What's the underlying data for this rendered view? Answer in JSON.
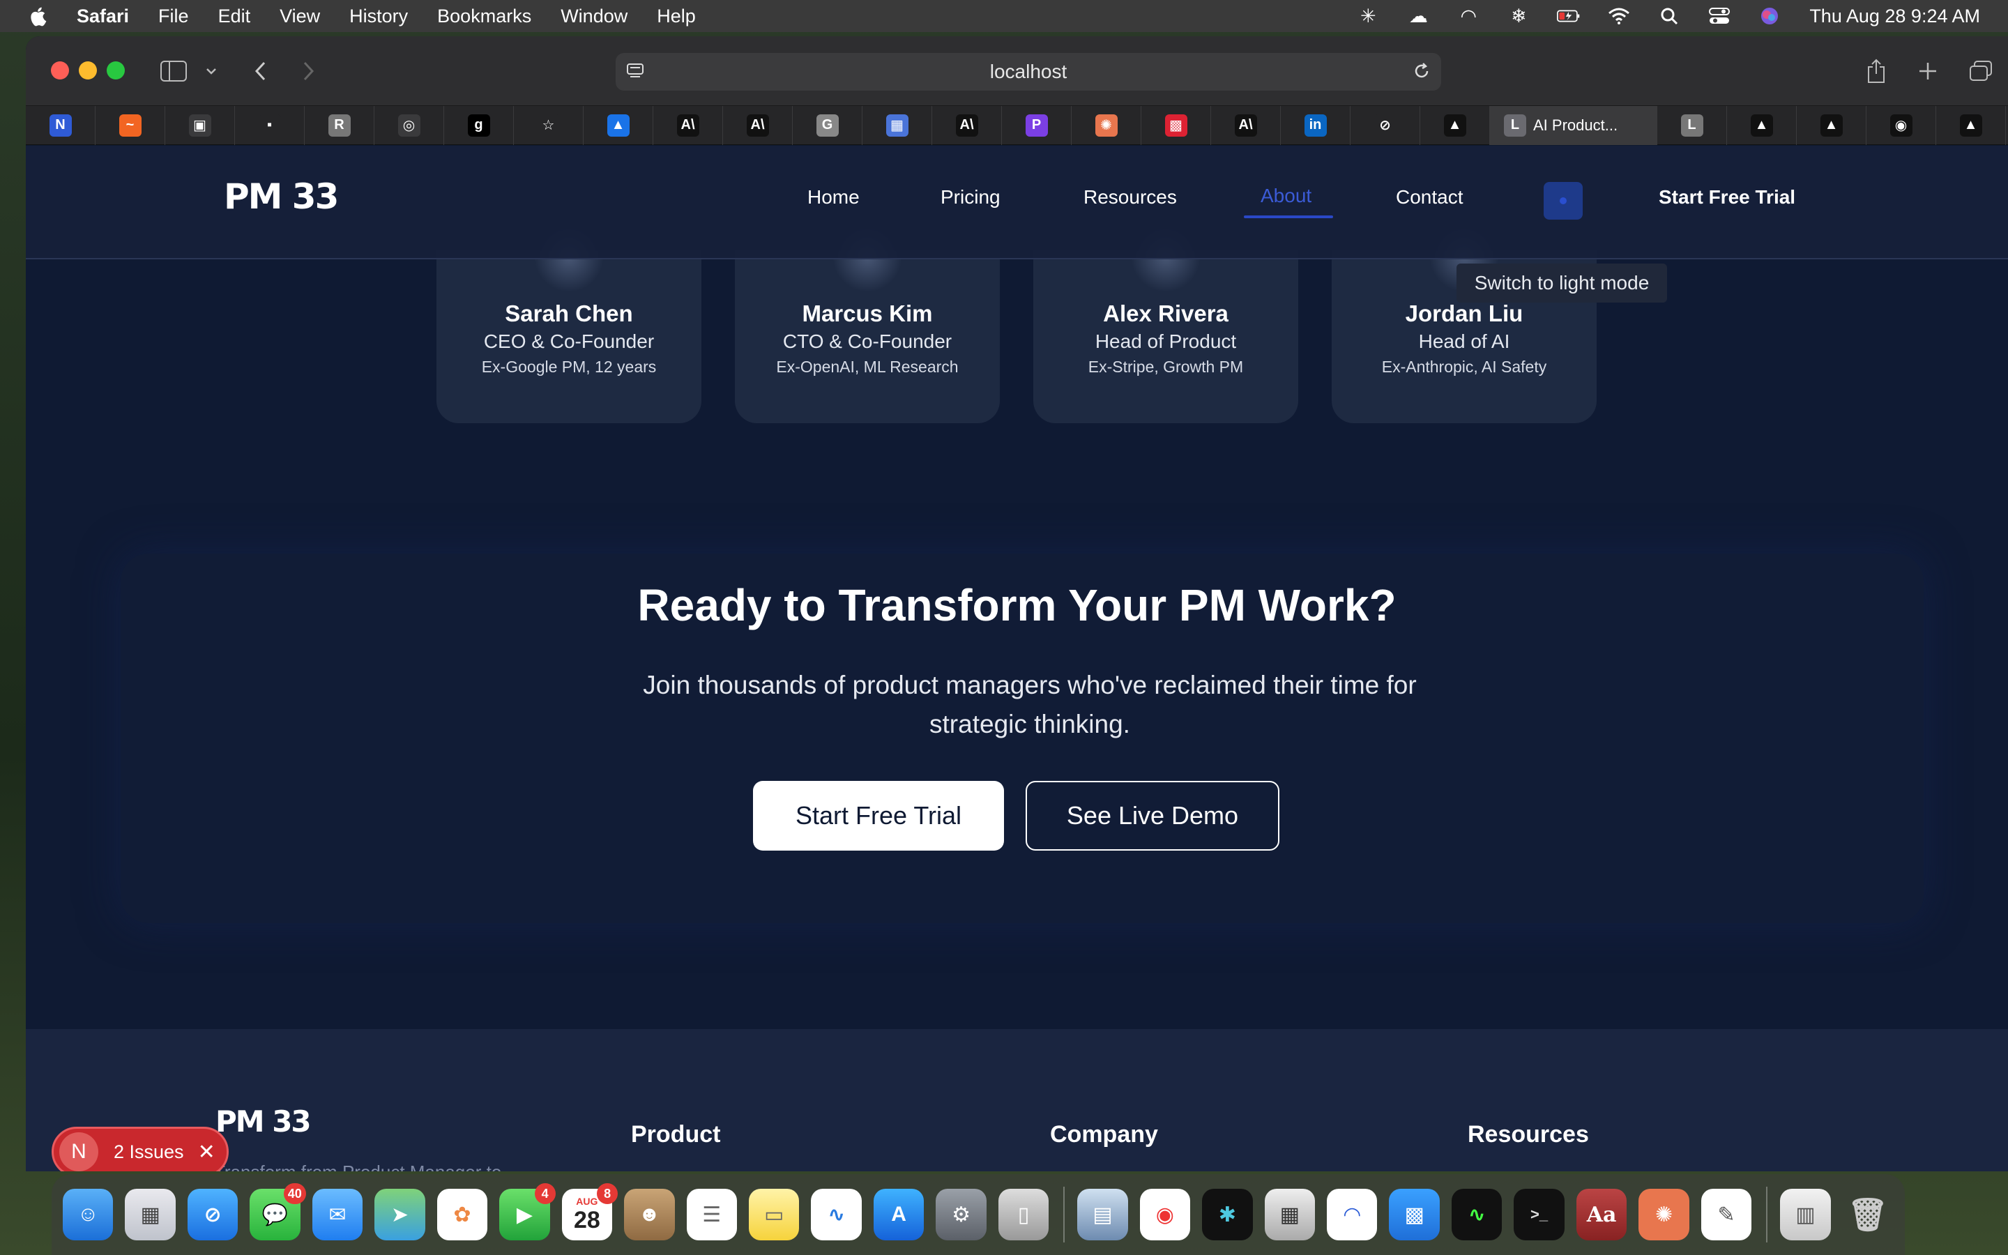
{
  "menubar": {
    "app": "Safari",
    "items": [
      "File",
      "Edit",
      "View",
      "History",
      "Bookmarks",
      "Window",
      "Help"
    ],
    "clock": "Thu Aug 28  9:24 AM",
    "status_icons": [
      "asterisk-icon",
      "cloud-icon",
      "arc-icon",
      "snowflake-icon",
      "battery-icon",
      "wifi-icon",
      "search-icon",
      "control-center-icon",
      "siri-icon"
    ]
  },
  "browser": {
    "url": "localhost",
    "active_tab": "AI Product...",
    "favorites": [
      {
        "glyph": "N",
        "color": "#2f5bd6"
      },
      {
        "glyph": "~",
        "color": "#f26522"
      },
      {
        "glyph": "▣",
        "color": "#3a3a3c"
      },
      {
        "glyph": "▪",
        "color": "#262628"
      },
      {
        "glyph": "R",
        "color": "#777"
      },
      {
        "glyph": "◎",
        "color": "#3a3a3c"
      },
      {
        "glyph": "g",
        "color": "#000"
      },
      {
        "glyph": "☆",
        "color": "#262628"
      },
      {
        "glyph": "▲",
        "color": "#1a73e8"
      },
      {
        "glyph": "A\\",
        "color": "#111"
      },
      {
        "glyph": "A\\",
        "color": "#111"
      },
      {
        "glyph": "G",
        "color": "#888"
      },
      {
        "glyph": "▦",
        "color": "#4a74d9"
      },
      {
        "glyph": "A\\",
        "color": "#111"
      },
      {
        "glyph": "P",
        "color": "#7b3fe4"
      },
      {
        "glyph": "✺",
        "color": "#e8764e"
      },
      {
        "glyph": "▩",
        "color": "#d23"
      },
      {
        "glyph": "A\\",
        "color": "#111"
      },
      {
        "glyph": "in",
        "color": "#0a66c2"
      },
      {
        "glyph": "⊘",
        "color": "#262628"
      },
      {
        "glyph": "▲",
        "color": "#111"
      }
    ],
    "favorites_after": [
      {
        "glyph": "L",
        "color": "#777"
      },
      {
        "glyph": "▲",
        "color": "#111"
      },
      {
        "glyph": "▲",
        "color": "#111"
      },
      {
        "glyph": "◉",
        "color": "#111"
      },
      {
        "glyph": "▲",
        "color": "#111"
      }
    ]
  },
  "site": {
    "logo": "PM 33",
    "nav": {
      "home": "Home",
      "pricing": "Pricing",
      "resources": "Resources",
      "about": "About",
      "contact": "Contact",
      "cta": "Start Free Trial",
      "tooltip": "Switch to light mode"
    },
    "team": [
      {
        "name": "Sarah Chen",
        "role": "CEO & Co-Founder",
        "background": "Ex-Google PM, 12 years"
      },
      {
        "name": "Marcus Kim",
        "role": "CTO & Co-Founder",
        "background": "Ex-OpenAI, ML Research"
      },
      {
        "name": "Alex Rivera",
        "role": "Head of Product",
        "background": "Ex-Stripe, Growth PM"
      },
      {
        "name": "Jordan Liu",
        "role": "Head of AI",
        "background": "Ex-Anthropic, AI Safety"
      }
    ],
    "cta": {
      "title": "Ready to Transform Your PM Work?",
      "subtitle": "Join thousands of product managers who've reclaimed their time for strategic thinking.",
      "primary": "Start Free Trial",
      "secondary": "See Live Demo"
    },
    "footer": {
      "logo": "PM 33",
      "product": "Product",
      "company": "Company",
      "resources": "Resources",
      "tagline": "Transform from Product Manager to"
    }
  },
  "dev_overlay": {
    "badge_letter": "N",
    "issues": "2 Issues"
  },
  "dock": {
    "calendar_month": "AUG",
    "calendar_day": "28",
    "badges": {
      "messages": "40",
      "facetime": "4",
      "calendar": "8"
    }
  }
}
